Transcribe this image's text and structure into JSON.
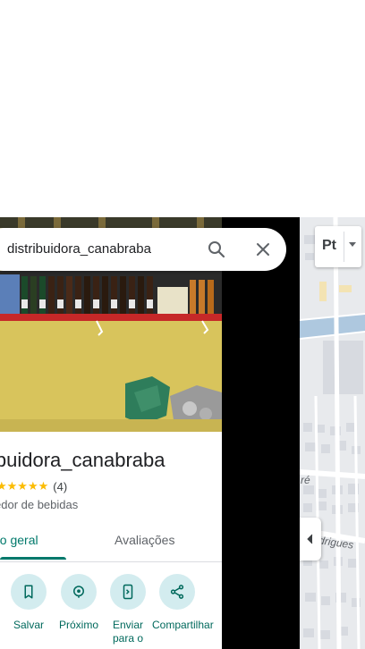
{
  "search": {
    "query": "distribuidora_canabraba"
  },
  "place": {
    "title": "ibuidora_canabraba",
    "stars": "★★★★★",
    "review_count": "(4)",
    "category": "edor de bebidas"
  },
  "tabs": [
    {
      "label": "ão geral",
      "selected": true
    },
    {
      "label": "Avaliações",
      "selected": false
    }
  ],
  "actions": [
    {
      "label": "Salvar",
      "icon": "bookmark-icon"
    },
    {
      "label": "Próximo",
      "icon": "nearby-icon"
    },
    {
      "label": "Enviar para o",
      "icon": "send-to-phone-icon"
    },
    {
      "label": "Compartilhar",
      "icon": "share-icon"
    }
  ],
  "map": {
    "language_button": "Pt",
    "street_label_1": "ré",
    "street_label_2": "drigues"
  },
  "colors": {
    "accent": "#00796b",
    "action_circle": "#d3ecef",
    "star": "#fbbc04"
  }
}
